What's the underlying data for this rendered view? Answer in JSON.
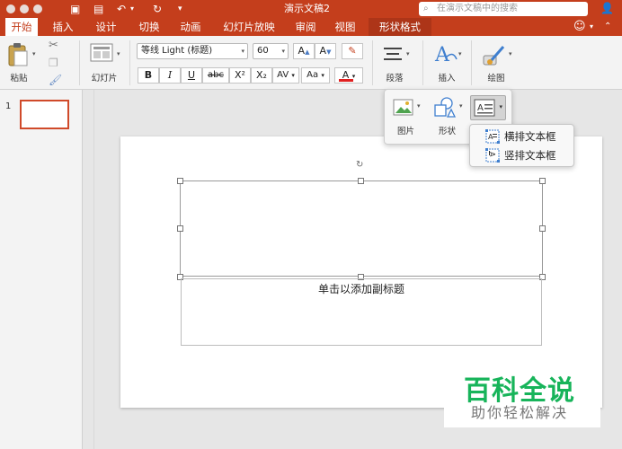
{
  "window": {
    "title": "演示文稿2",
    "search_placeholder": "在演示文稿中的搜索"
  },
  "tabs": [
    {
      "label": "开始"
    },
    {
      "label": "插入"
    },
    {
      "label": "设计"
    },
    {
      "label": "切换"
    },
    {
      "label": "动画"
    },
    {
      "label": "幻灯片放映"
    },
    {
      "label": "审阅"
    },
    {
      "label": "视图"
    },
    {
      "label": "形状格式"
    }
  ],
  "ribbon": {
    "paste_label": "粘贴",
    "slides_label": "幻灯片",
    "font_name": "等线 Light (标题)",
    "font_size": "60",
    "bold": "B",
    "italic": "I",
    "underline": "U",
    "strike": "abc",
    "superscript": "X²",
    "subscript": "X₂",
    "char_spacing": "AV",
    "change_case": "Aa",
    "font_color": "A",
    "grow_font": "A",
    "shrink_font": "A",
    "paragraph_label": "段落",
    "insert_label": "插入",
    "draw_label": "绘图"
  },
  "insert_popup": {
    "picture_label": "图片",
    "shape_label": "形状"
  },
  "textbox_menu": {
    "items": [
      {
        "label": "横排文本框"
      },
      {
        "label": "竖排文本框"
      }
    ]
  },
  "slides_panel": {
    "slide_number": "1"
  },
  "slide": {
    "subtitle_placeholder": "单击以添加副标题"
  },
  "watermark": {
    "title": "百科全说",
    "subtitle": "助你轻松解决"
  },
  "colors": {
    "accent": "#c43e1c",
    "watermark_green": "#17b45a",
    "font_color_bar": "#e02020"
  }
}
